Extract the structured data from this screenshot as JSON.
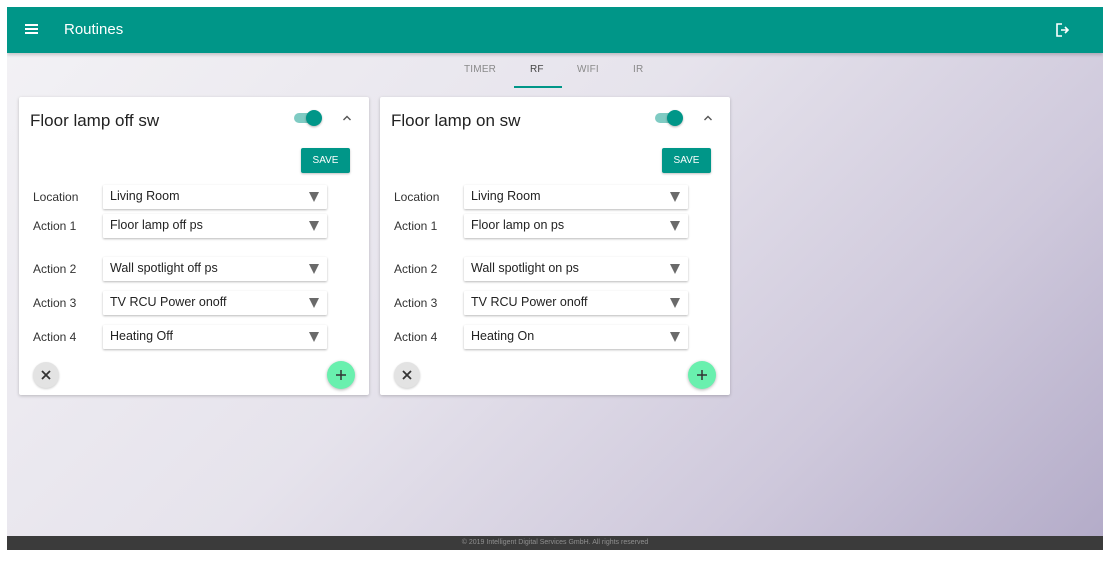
{
  "app": {
    "title": "Routines",
    "menu_icon": "menu-icon",
    "logout_icon": "logout-icon",
    "accent_color": "#009688",
    "add_button_color": "#69f0ae"
  },
  "tabs": [
    {
      "label": "TIMER",
      "active": false
    },
    {
      "label": "RF",
      "active": true
    },
    {
      "label": "WIFI",
      "active": false
    },
    {
      "label": "IR",
      "active": false
    }
  ],
  "cards": [
    {
      "title": "Floor lamp off sw",
      "enabled": true,
      "save_label": "SAVE",
      "fields": [
        {
          "label": "Location",
          "value": "Living Room"
        },
        {
          "label": "Action 1",
          "value": "Floor lamp off ps"
        },
        {
          "label": "Action 2",
          "value": "Wall spotlight off ps"
        },
        {
          "label": "Action 3",
          "value": "TV RCU Power onoff"
        },
        {
          "label": "Action 4",
          "value": "Heating Off"
        }
      ]
    },
    {
      "title": "Floor lamp on sw",
      "enabled": true,
      "save_label": "SAVE",
      "fields": [
        {
          "label": "Location",
          "value": "Living Room"
        },
        {
          "label": "Action 1",
          "value": "Floor lamp on ps"
        },
        {
          "label": "Action 2",
          "value": "Wall spotlight on ps"
        },
        {
          "label": "Action 3",
          "value": "TV RCU Power onoff"
        },
        {
          "label": "Action 4",
          "value": "Heating On"
        }
      ]
    }
  ],
  "footer": {
    "text": "© 2019 Intelligent Digital Services GmbH. All rights reserved"
  }
}
